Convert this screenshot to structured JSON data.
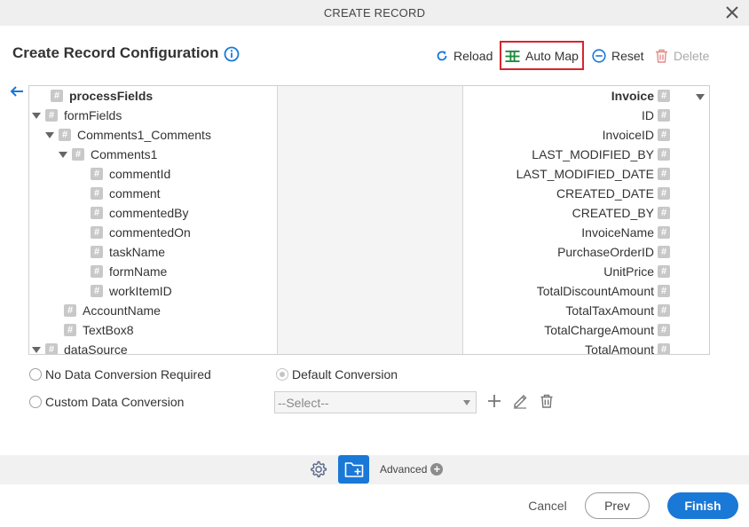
{
  "dialog": {
    "title": "CREATE RECORD"
  },
  "heading": "Create Record Configuration",
  "toolbar": {
    "reload": "Reload",
    "auto_map": "Auto Map",
    "reset": "Reset",
    "delete": "Delete"
  },
  "left_tree": [
    {
      "label": "processFields",
      "bold": true
    },
    {
      "label": "formFields"
    },
    {
      "label": "Comments1_Comments"
    },
    {
      "label": "Comments1"
    },
    {
      "label": "commentId"
    },
    {
      "label": "comment"
    },
    {
      "label": "commentedBy"
    },
    {
      "label": "commentedOn"
    },
    {
      "label": "taskName"
    },
    {
      "label": "formName"
    },
    {
      "label": "workItemID"
    },
    {
      "label": "AccountName"
    },
    {
      "label": "TextBox8"
    },
    {
      "label": "dataSource"
    }
  ],
  "right_tree": [
    {
      "label": "Invoice",
      "bold": true
    },
    {
      "label": "ID"
    },
    {
      "label": "InvoiceID"
    },
    {
      "label": "LAST_MODIFIED_BY"
    },
    {
      "label": "LAST_MODIFIED_DATE"
    },
    {
      "label": "CREATED_DATE"
    },
    {
      "label": "CREATED_BY"
    },
    {
      "label": "InvoiceName"
    },
    {
      "label": "PurchaseOrderID"
    },
    {
      "label": "UnitPrice"
    },
    {
      "label": "TotalDiscountAmount"
    },
    {
      "label": "TotalTaxAmount"
    },
    {
      "label": "TotalChargeAmount"
    },
    {
      "label": "TotalAmount"
    }
  ],
  "conversion": {
    "no_conversion": "No Data Conversion Required",
    "default_conversion": "Default Conversion",
    "custom_conversion": "Custom Data Conversion",
    "select_value": "--Select--",
    "selected": "default_conversion"
  },
  "footer": {
    "advanced": "Advanced",
    "cancel": "Cancel",
    "prev": "Prev",
    "finish": "Finish"
  },
  "colors": {
    "accent": "#1a78d6",
    "highlight": "#d9232e",
    "mapping_icon": "#1a8a3c"
  }
}
